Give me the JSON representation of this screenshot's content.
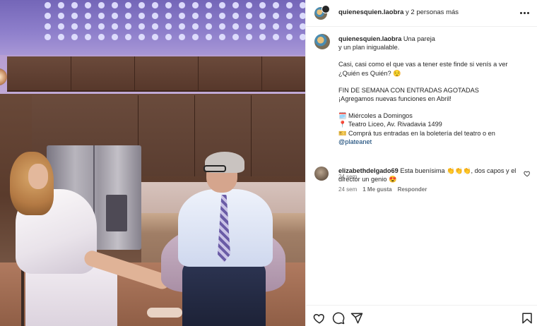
{
  "header": {
    "username": "quienesquien.laobra",
    "others": " y 2 personas más"
  },
  "caption": {
    "username": "quienesquien.laobra",
    "line1_rest": " Una pareja",
    "line2": "y un plan inigualable.",
    "para2": "Casi, casi como el que vas a tener este finde si venís a ver ¿Quién es Quién? 😌",
    "para3_l1": "FIN DE SEMANA CON ENTRADAS AGOTADAS",
    "para3_l2": "¡Agregamos nuevas funciones en Abril!",
    "info1": "🗓️ Miércoles a Domingos",
    "info2": "📍 Teatro Liceo, Av. Rivadavia 1499",
    "info3": "🎫 Comprá tus entradas en la boletería del teatro o en",
    "link": "@plateanet",
    "time": "24 sem"
  },
  "comment": {
    "username": "elizabethdelgado69",
    "text": " Esta buenísima 👏👏👏, dos capos y el director un genio 😍",
    "time": "24 sem",
    "likes": "1 Me gusta",
    "reply": "Responder"
  },
  "icons": {
    "more": "more-horizontal-icon",
    "like": "heart-icon",
    "comment": "comment-icon",
    "share": "share-icon",
    "save": "bookmark-icon"
  }
}
